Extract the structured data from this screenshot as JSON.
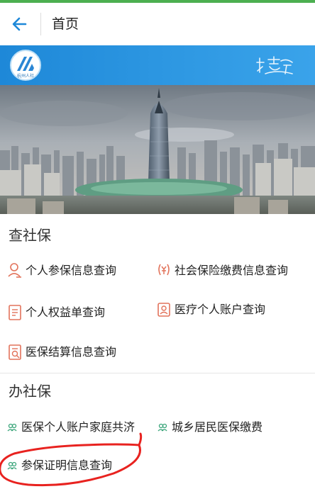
{
  "header": {
    "title": "首页",
    "back_icon": "arrow-left-icon",
    "accent_color": "#1e88d8",
    "status_strip_color": "#4caf50"
  },
  "banner": {
    "logo_caption": "杭州人社",
    "logo_icon": "hz-hrss-logo",
    "emblem_icon": "hangzhou-city-emblem"
  },
  "hero": {
    "image": "hangzhou-skyline-photo"
  },
  "query_section": {
    "title": "查社保",
    "items": [
      {
        "label": "个人参保信息查询",
        "icon": "person-icon"
      },
      {
        "label": "社会保险缴费信息查询",
        "icon": "yen-icon"
      },
      {
        "label": "个人权益单查询",
        "icon": "document-icon"
      },
      {
        "label": "医疗个人账户查询",
        "icon": "medical-card-icon"
      },
      {
        "label": "医保结算信息查询",
        "icon": "receipt-icon"
      }
    ]
  },
  "service_section": {
    "title": "办社保",
    "items": [
      {
        "label": "医保个人账户家庭共济",
        "icon": "people-icon"
      },
      {
        "label": "城乡居民医保缴费",
        "icon": "people-icon"
      },
      {
        "label": "参保证明信息查询",
        "icon": "people-icon"
      }
    ]
  },
  "annotation": {
    "color": "#e8221f"
  }
}
